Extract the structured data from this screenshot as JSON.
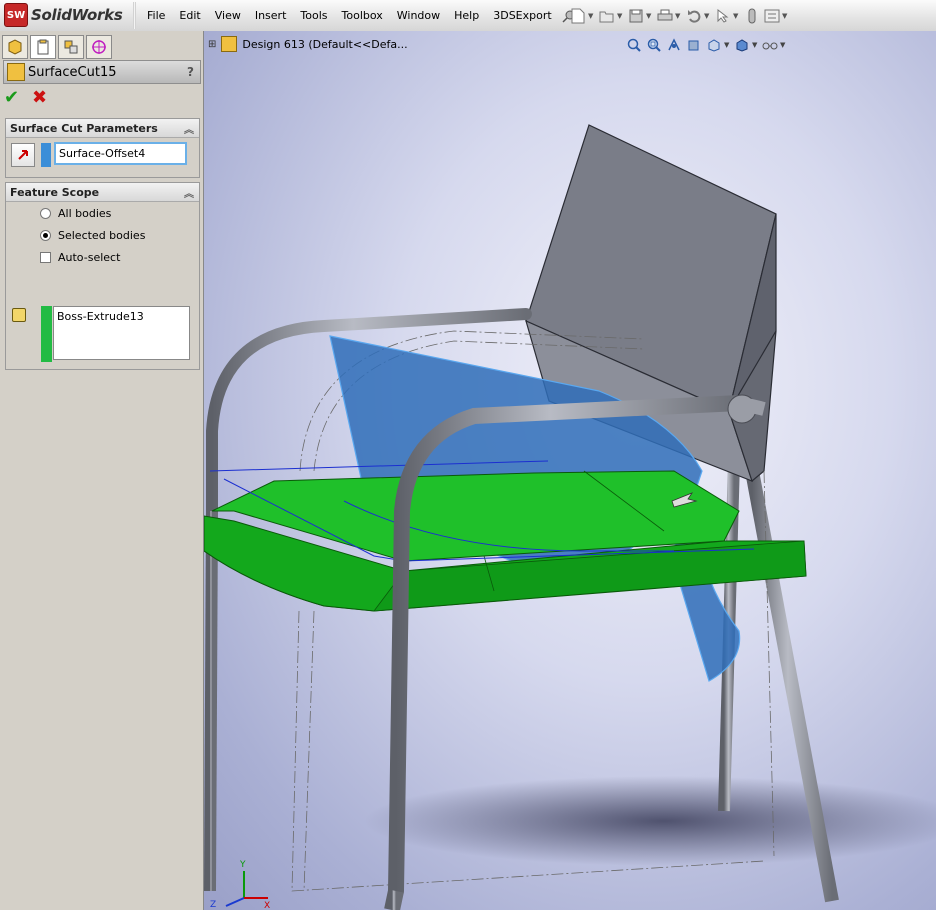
{
  "app": {
    "brand": "SolidWorks",
    "logo_text": "SW"
  },
  "menu": [
    "File",
    "Edit",
    "View",
    "Insert",
    "Tools",
    "Toolbox",
    "Window",
    "Help",
    "3DSExport"
  ],
  "pm_tabs": [
    "feature-manager-icon",
    "property-manager-icon",
    "configuration-manager-icon",
    "dimxpert-icon"
  ],
  "property_manager": {
    "title": "SurfaceCut15",
    "help": "?",
    "ok_symbol": "✔",
    "cancel_symbol": "✖",
    "surface_cut": {
      "heading": "Surface Cut Parameters",
      "selection": "Surface-Offset4",
      "selection_color": "#3b8ed8"
    },
    "feature_scope": {
      "heading": "Feature Scope",
      "options": [
        {
          "label": "All bodies",
          "selected": false
        },
        {
          "label": "Selected bodies",
          "selected": true
        }
      ],
      "auto_select_label": "Auto-select",
      "auto_select_checked": false,
      "bodies": [
        "Boss-Extrude13"
      ],
      "bodies_color": "#22bb44"
    }
  },
  "viewport": {
    "tree_flyout": "Design 613  (Default<<Defa...",
    "view_tools": [
      "zoom-to-fit-icon",
      "zoom-area-icon",
      "previous-view-icon",
      "section-view-icon",
      "view-orientation-icon",
      "display-style-icon",
      "hide-show-icon"
    ],
    "triad": {
      "x": "X",
      "y": "Y",
      "z": "Z"
    },
    "colors": {
      "seat": "#16b31e",
      "surface": "#2f6db8",
      "frame": "#8a8c94",
      "backrest": "#7a7d88"
    }
  }
}
